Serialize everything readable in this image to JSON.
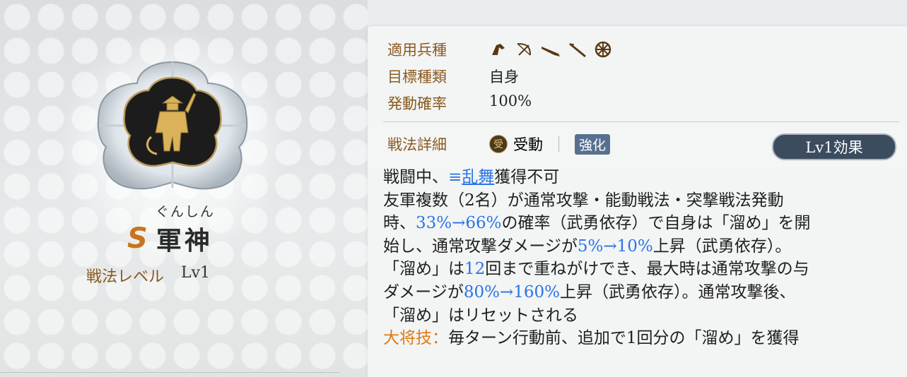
{
  "skill": {
    "furigana": "ぐんしん",
    "rank": "S",
    "name": "軍神",
    "level_label": "戦法レベル",
    "level_value": "Lv1"
  },
  "info": {
    "unit_type_label": "適用兵種",
    "unit_icons": [
      "cavalry-icon",
      "bow-icon",
      "gun-icon",
      "spear-icon",
      "wheel-icon"
    ],
    "target_label": "目標種類",
    "target_value": "自身",
    "rate_label": "発動確率",
    "rate_value": "100%"
  },
  "detail": {
    "label": "戦法詳細",
    "passive_symbol": "受",
    "type_value": "受動",
    "tag": "強化",
    "lv_effect_button": "Lv1効果"
  },
  "description": {
    "l1_pre": "戦闘中、",
    "l1_link_icon": "≡",
    "l1_link": "乱舞",
    "l1_post": "獲得不可",
    "l2": "友軍複数（2名）が通常攻撃・能動戦法・突撃戦法発動",
    "l3_pre": "時、",
    "l3_blue": "33%→66%",
    "l3_post": "の確率（武勇依存）で自身は「溜め」を開",
    "l4_pre": "始し、通常攻撃ダメージが",
    "l4_blue": "5%→10%",
    "l4_post": "上昇（武勇依存）。",
    "l5_pre": "「溜め」は",
    "l5_blue": "12",
    "l5_post": "回まで重ねがけでき、最大時は通常攻撃の与",
    "l6_pre": "ダメージが",
    "l6_blue": "80%→160%",
    "l6_post": "上昇（武勇依存）。通常攻撃後、",
    "l7": "「溜め」はリセットされる",
    "l8_label": "大将技",
    "l8_colon": "：",
    "l8_text": "毎ターン行動前、追加で1回分の「溜め」を獲得"
  },
  "colors": {
    "accent_brown": "#8a5a1e",
    "value_blue": "#2a74e6",
    "general_orange": "#e07a14",
    "rank_orange": "#c9741c"
  }
}
